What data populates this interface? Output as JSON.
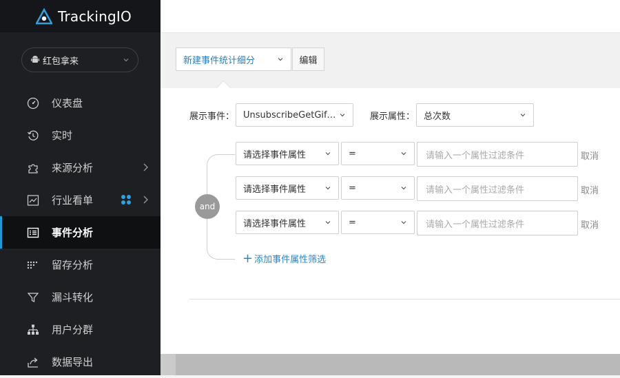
{
  "brand": {
    "name": "TrackingIO"
  },
  "app_select": {
    "value": "红包拿来",
    "icon": "android-icon"
  },
  "nav": {
    "items": [
      {
        "label": "仪表盘",
        "icon": "dashboard-icon",
        "active": false,
        "arrow": false
      },
      {
        "label": "实时",
        "icon": "history-icon",
        "active": false,
        "arrow": false
      },
      {
        "label": "来源分析",
        "icon": "puzzle-icon",
        "active": false,
        "arrow": true
      },
      {
        "label": "行业看单",
        "icon": "chart-line-icon",
        "active": false,
        "arrow": true,
        "badge": "grid-icon"
      },
      {
        "label": "事件分析",
        "icon": "list-icon",
        "active": true,
        "arrow": false
      },
      {
        "label": "留存分析",
        "icon": "dots-grid-icon",
        "active": false,
        "arrow": false
      },
      {
        "label": "漏斗转化",
        "icon": "funnel-icon",
        "active": false,
        "arrow": false
      },
      {
        "label": "用户分群",
        "icon": "hierarchy-icon",
        "active": false,
        "arrow": false
      },
      {
        "label": "数据导出",
        "icon": "export-icon",
        "active": false,
        "arrow": false
      }
    ]
  },
  "toolbar": {
    "analysis_select": "新建事件统计细分",
    "edit_label": "编辑"
  },
  "panel": {
    "event_label": "展示事件：",
    "event_value": "UnsubscribeGetGiftE...",
    "attr_label": "展示属性：",
    "attr_value": "总次数",
    "and_label": "and",
    "filters": [
      {
        "property": "请选择事件属性",
        "operator": "=",
        "placeholder": "请输入一个属性过滤条件",
        "cancel": "取消"
      },
      {
        "property": "请选择事件属性",
        "operator": "=",
        "placeholder": "请输入一个属性过滤条件",
        "cancel": "取消"
      },
      {
        "property": "请选择事件属性",
        "operator": "=",
        "placeholder": "请输入一个属性过滤条件",
        "cancel": "取消"
      }
    ],
    "add_filter": "添加事件属性筛选"
  },
  "colors": {
    "accent": "#1a9bd7",
    "link": "#2a86c9",
    "sidebar_bg": "#1e1f23"
  }
}
